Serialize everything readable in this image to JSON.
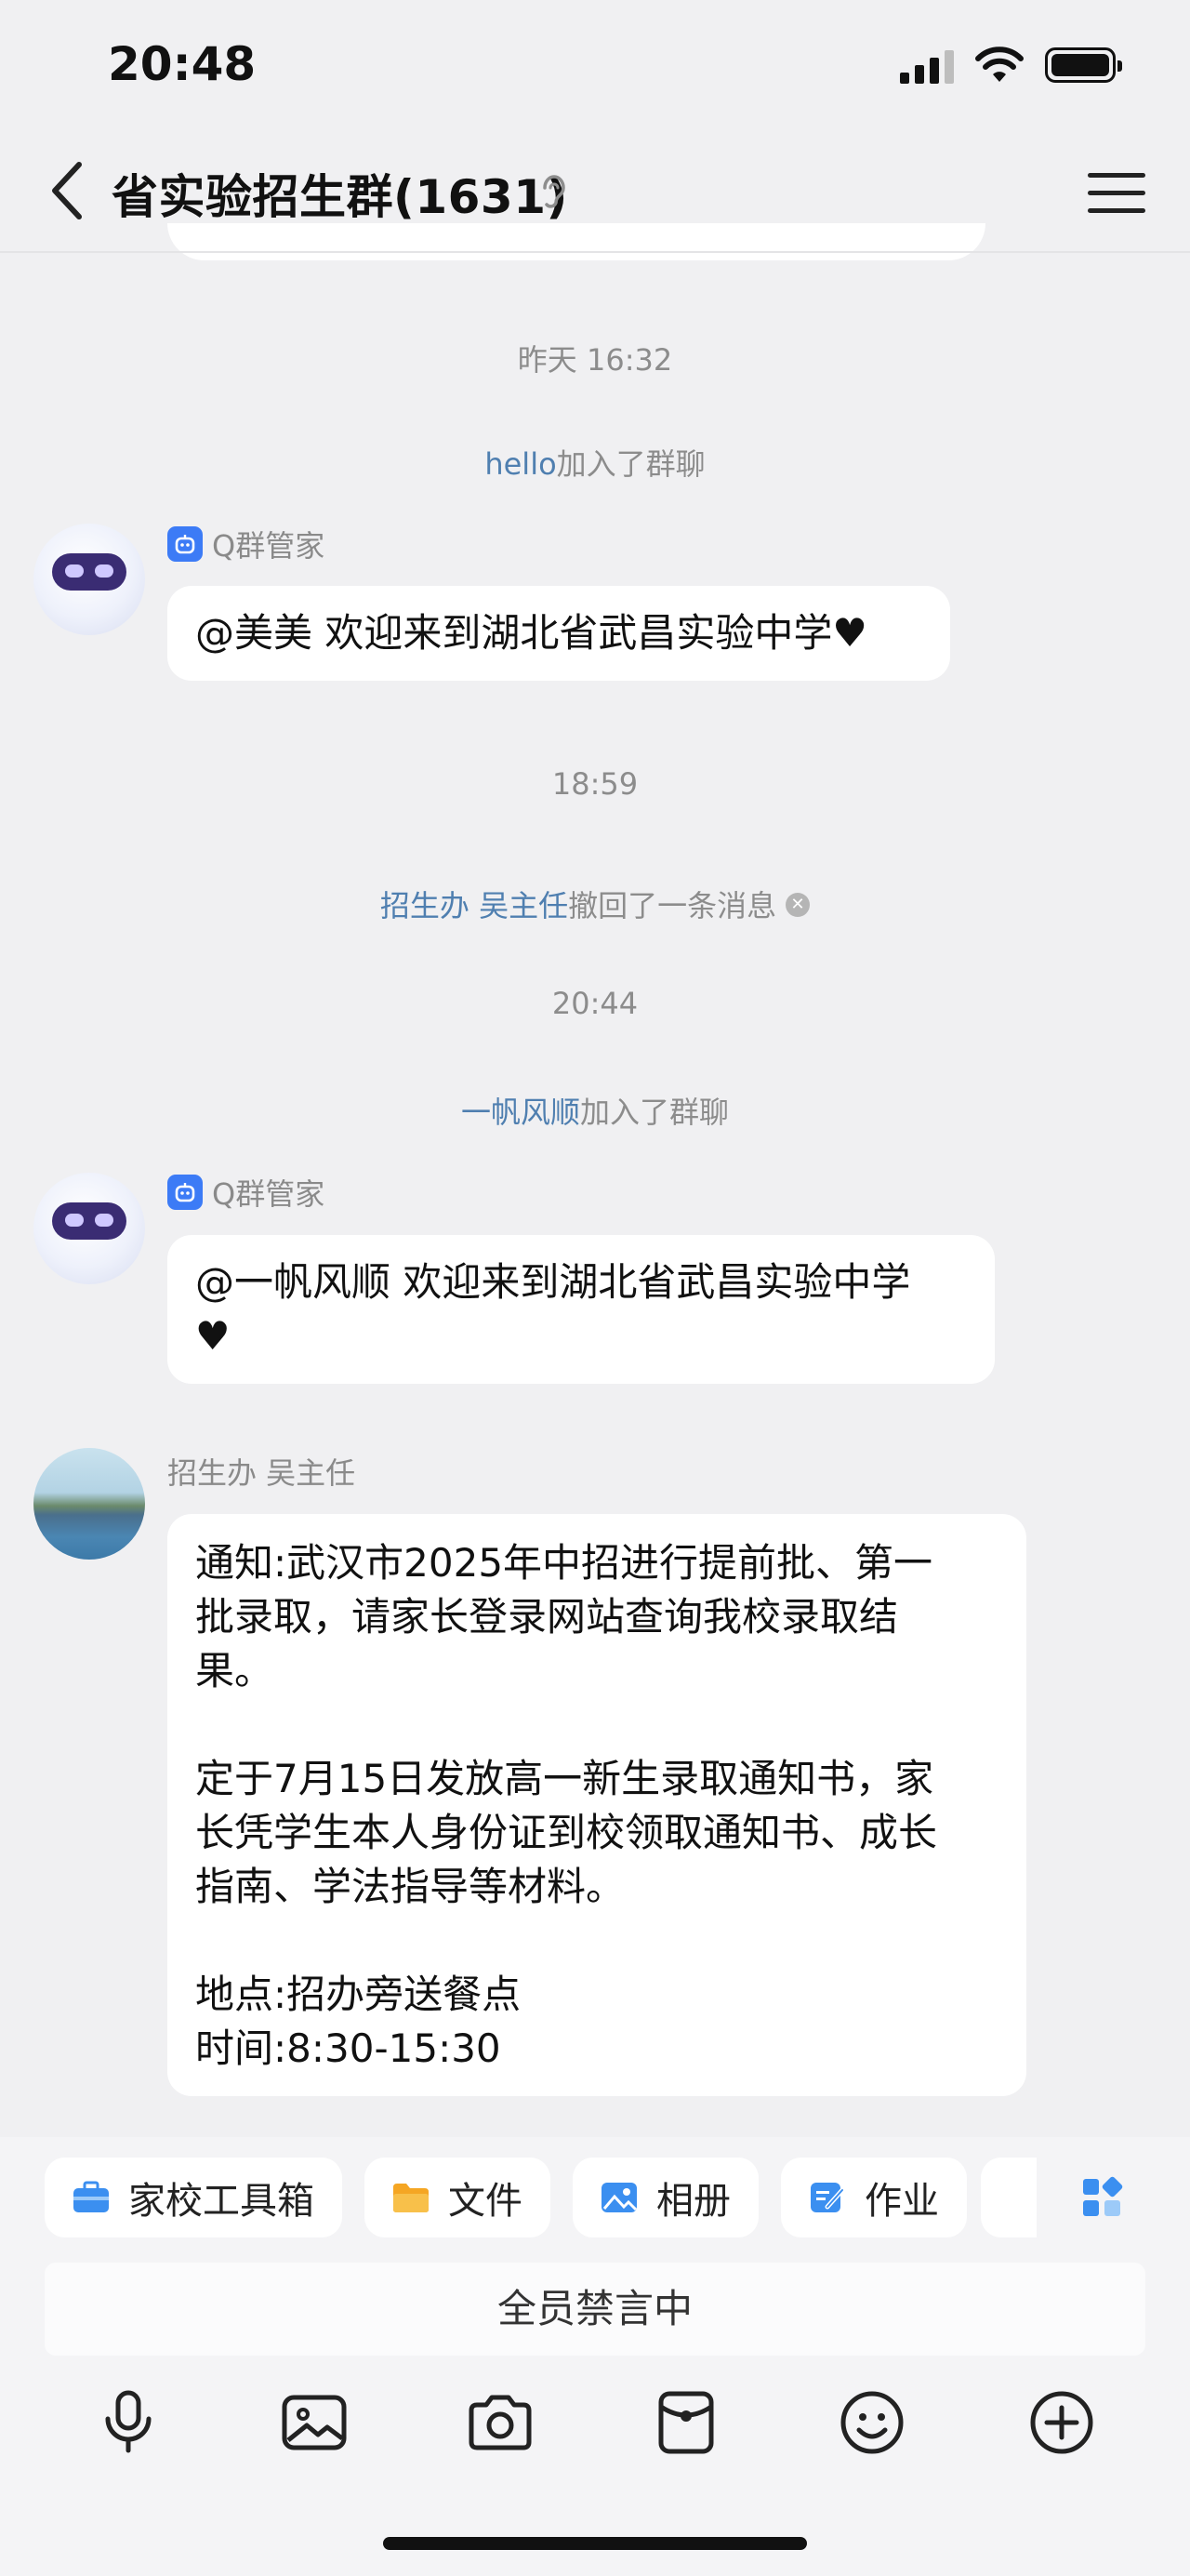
{
  "status_bar": {
    "time": "20:48"
  },
  "header": {
    "title": "省实验招生群(1631)"
  },
  "chat": {
    "timestamps": [
      "昨天 16:32",
      "18:59",
      "20:44"
    ],
    "joins": [
      {
        "name": "hello",
        "suffix": "加入了群聊"
      },
      {
        "name": "一帆风顺",
        "suffix": "加入了群聊"
      }
    ],
    "recall": {
      "name": "招生办 吴主任",
      "suffix": "撤回了一条消息"
    },
    "messages": [
      {
        "sender": "Q群管家",
        "lines": [
          "@美美 欢迎来到湖北省武昌实验中学♥"
        ]
      },
      {
        "sender": "Q群管家",
        "lines": [
          "@一帆风顺 欢迎来到湖北省武昌实验中学",
          "♥"
        ]
      },
      {
        "sender": "招生办 吴主任",
        "lines": [
          "通知:武汉市2025年中招进行提前批、第一",
          "批录取，请家长登录网站查询我校录取结",
          "果。",
          "",
          "定于7月15日发放高一新生录取通知书，家",
          "长凭学生本人身份证到校领取通知书、成长",
          "指南、学法指导等材料。",
          "",
          "地点:招办旁送餐点",
          "时间:8:30-15:30"
        ]
      }
    ]
  },
  "tools": [
    {
      "label": "家校工具箱",
      "icon": "toolbox-icon"
    },
    {
      "label": "文件",
      "icon": "folder-icon"
    },
    {
      "label": "相册",
      "icon": "album-icon"
    },
    {
      "label": "作业",
      "icon": "homework-icon"
    }
  ],
  "input": {
    "muted_text": "全员禁言中"
  },
  "colors": {
    "link": "#4f7fb0",
    "accent": "#3c7bf6",
    "background": "#f0f0f2"
  }
}
